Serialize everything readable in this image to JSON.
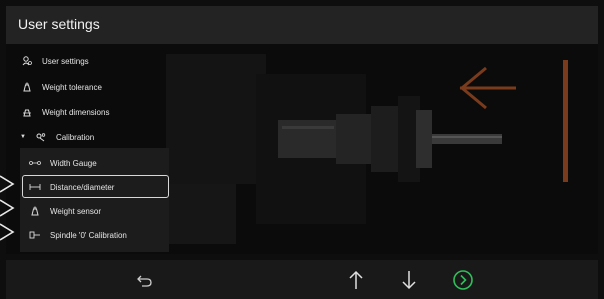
{
  "header": {
    "title": "User settings"
  },
  "menu": {
    "items": [
      {
        "label": "User settings",
        "icon": "user-settings-icon"
      },
      {
        "label": "Weight tolerance",
        "icon": "weight-tolerance-icon"
      },
      {
        "label": "Weight dimensions",
        "icon": "weight-dimensions-icon"
      },
      {
        "label": "Calibration",
        "icon": "calibration-icon",
        "expanded": true
      }
    ],
    "submenu": [
      {
        "label": "Width Gauge",
        "icon": "width-gauge-icon"
      },
      {
        "label": "Distance/diameter",
        "icon": "distance-diameter-icon",
        "selected": true
      },
      {
        "label": "Weight sensor",
        "icon": "weight-sensor-icon"
      },
      {
        "label": "Spindle '0' Calibration",
        "icon": "spindle-calibration-icon"
      }
    ]
  },
  "bottom_bar": {
    "buttons": [
      "back",
      "up",
      "down",
      "confirm"
    ]
  },
  "colors": {
    "accent_green": "#2fbf5a",
    "arrow_brown": "#7a3b1c",
    "header_bg": "#232323"
  }
}
